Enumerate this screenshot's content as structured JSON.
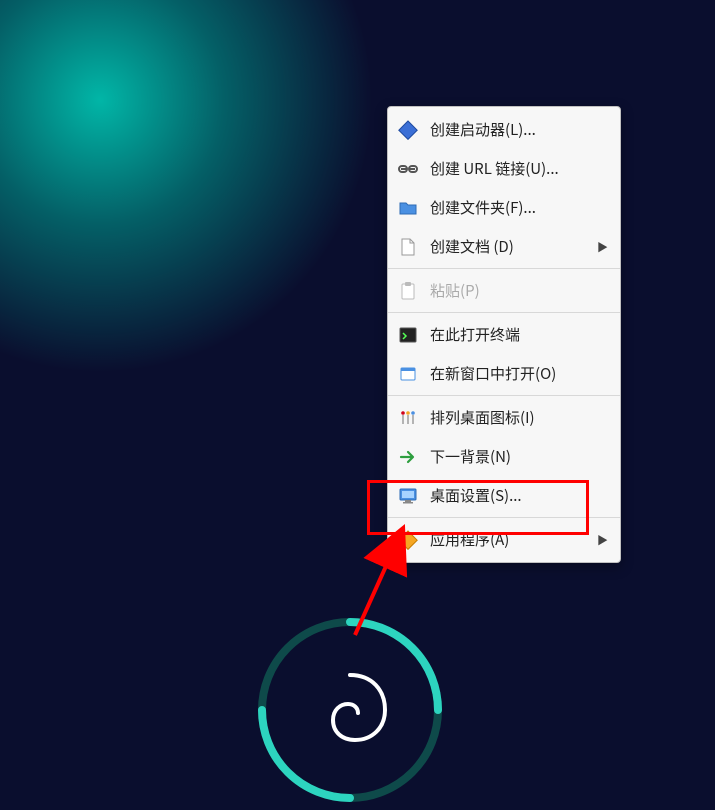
{
  "menu": {
    "items": [
      {
        "id": "create-launcher",
        "label": "创建启动器(L)...",
        "icon": "diamond-blue",
        "submenu": false,
        "disabled": false
      },
      {
        "id": "create-url-link",
        "label": "创建 URL 链接(U)...",
        "icon": "link-chain",
        "submenu": false,
        "disabled": false
      },
      {
        "id": "create-folder",
        "label": "创建文件夹(F)...",
        "icon": "folder-blue",
        "submenu": false,
        "disabled": false
      },
      {
        "id": "create-document",
        "label": "创建文档 (D)",
        "icon": "document-blank",
        "submenu": true,
        "disabled": false
      },
      {
        "sep": true
      },
      {
        "id": "paste",
        "label": "粘贴(P)",
        "icon": "clipboard",
        "submenu": false,
        "disabled": true
      },
      {
        "sep": true
      },
      {
        "id": "open-terminal",
        "label": "在此打开终端",
        "icon": "terminal",
        "submenu": false,
        "disabled": false
      },
      {
        "id": "open-in-new-win",
        "label": "在新窗口中打开(O)",
        "icon": "window-open",
        "submenu": false,
        "disabled": false
      },
      {
        "sep": true
      },
      {
        "id": "arrange-icons",
        "label": "排列桌面图标(I)",
        "icon": "sort-pins",
        "submenu": false,
        "disabled": false
      },
      {
        "id": "next-background",
        "label": "下一背景(N)",
        "icon": "arrow-next",
        "submenu": false,
        "disabled": false
      },
      {
        "id": "desktop-settings",
        "label": "桌面设置(S)...",
        "icon": "monitor",
        "submenu": false,
        "disabled": false
      },
      {
        "sep": true
      },
      {
        "id": "applications",
        "label": "应用程序(A)",
        "icon": "diamond-orange",
        "submenu": true,
        "disabled": false
      }
    ]
  },
  "annotation": {
    "highlighted_item_id": "desktop-settings"
  }
}
